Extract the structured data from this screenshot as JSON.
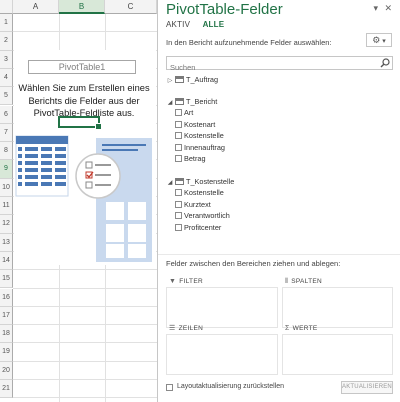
{
  "sheet": {
    "columns": [
      "A",
      "B",
      "C"
    ],
    "rows": [
      "1",
      "2",
      "3",
      "4",
      "5",
      "6",
      "7",
      "8",
      "9",
      "10",
      "11",
      "12",
      "13",
      "14",
      "15",
      "16",
      "17",
      "18",
      "19",
      "20",
      "21"
    ],
    "pivot_name": "PivotTable1",
    "instruction": "Wählen Sie zum Erstellen eines Berichts die Felder aus der PivotTable-Feldliste aus."
  },
  "pane": {
    "title": "PivotTable-Felder",
    "tabs": [
      {
        "label": "AKTIV"
      },
      {
        "label": "ALLE"
      }
    ],
    "active_tab": "ALLE",
    "instruction": "In den Bericht aufzunehmende Felder auswählen:",
    "gear_icon": "gear-icon",
    "search_placeholder": "Suchen",
    "tables": [
      {
        "name": "T_Auftrag",
        "expanded": false,
        "fields": []
      },
      {
        "name": "T_Bericht",
        "expanded": true,
        "fields": [
          "Art",
          "Kostenart",
          "Kostenstelle",
          "Innenauftrag",
          "Betrag"
        ]
      },
      {
        "name": "T_Kostenstelle",
        "expanded": true,
        "fields": [
          "Kostenstelle",
          "Kurztext",
          "Verantwortlich",
          "Profitcenter"
        ]
      }
    ],
    "areas_instruction": "Felder zwischen den Bereichen ziehen und ablegen:",
    "areas": {
      "filter": "FILTER",
      "columns": "SPALTEN",
      "rows": "ZEILEN",
      "values": "WERTE"
    },
    "defer_label": "Layoutaktualisierung zurückstellen",
    "update_button": "AKTUALISIEREN"
  },
  "colors": {
    "accent": "#217346",
    "pane_bg": "#ffffff",
    "illustration_blue": "#4a78b5"
  }
}
